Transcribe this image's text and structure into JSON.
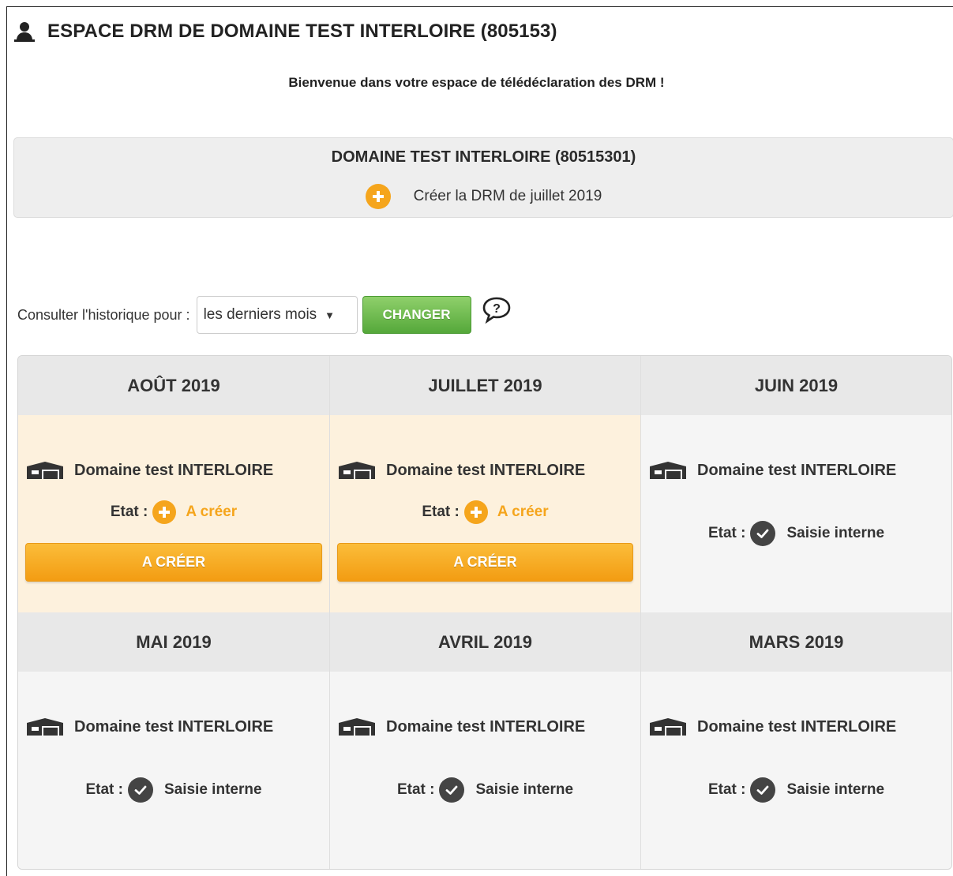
{
  "page": {
    "title": "ESPACE DRM DE DOMAINE TEST INTERLOIRE (805153)",
    "welcome": "Bienvenue dans votre espace de télédéclaration des DRM !"
  },
  "etablissement": {
    "name": "DOMAINE TEST INTERLOIRE (80515301)",
    "create_action": "Créer la DRM de juillet 2019"
  },
  "history": {
    "label": "Consulter l'historique pour :",
    "selected": "les derniers mois",
    "button": "CHANGER"
  },
  "months": [
    {
      "title": "AOÛT 2019",
      "etab": "Domaine test INTERLOIRE",
      "etat_label": "Etat :",
      "status": "A créer",
      "button": "A CRÉER"
    },
    {
      "title": "JUILLET 2019",
      "etab": "Domaine test INTERLOIRE",
      "etat_label": "Etat :",
      "status": "A créer",
      "button": "A CRÉER"
    },
    {
      "title": "JUIN 2019",
      "etab": "Domaine test INTERLOIRE",
      "etat_label": "Etat :",
      "status": "Saisie interne"
    },
    {
      "title": "MAI 2019",
      "etab": "Domaine test INTERLOIRE",
      "etat_label": "Etat :",
      "status": "Saisie interne"
    },
    {
      "title": "AVRIL 2019",
      "etab": "Domaine test INTERLOIRE",
      "etat_label": "Etat :",
      "status": "Saisie interne"
    },
    {
      "title": "MARS 2019",
      "etab": "Domaine test INTERLOIRE",
      "etat_label": "Etat :",
      "status": "Saisie interne"
    }
  ],
  "colors": {
    "accent_orange": "#f5a51c",
    "button_green": "#55a83a",
    "highlight_bg": "#fdf1dd"
  }
}
